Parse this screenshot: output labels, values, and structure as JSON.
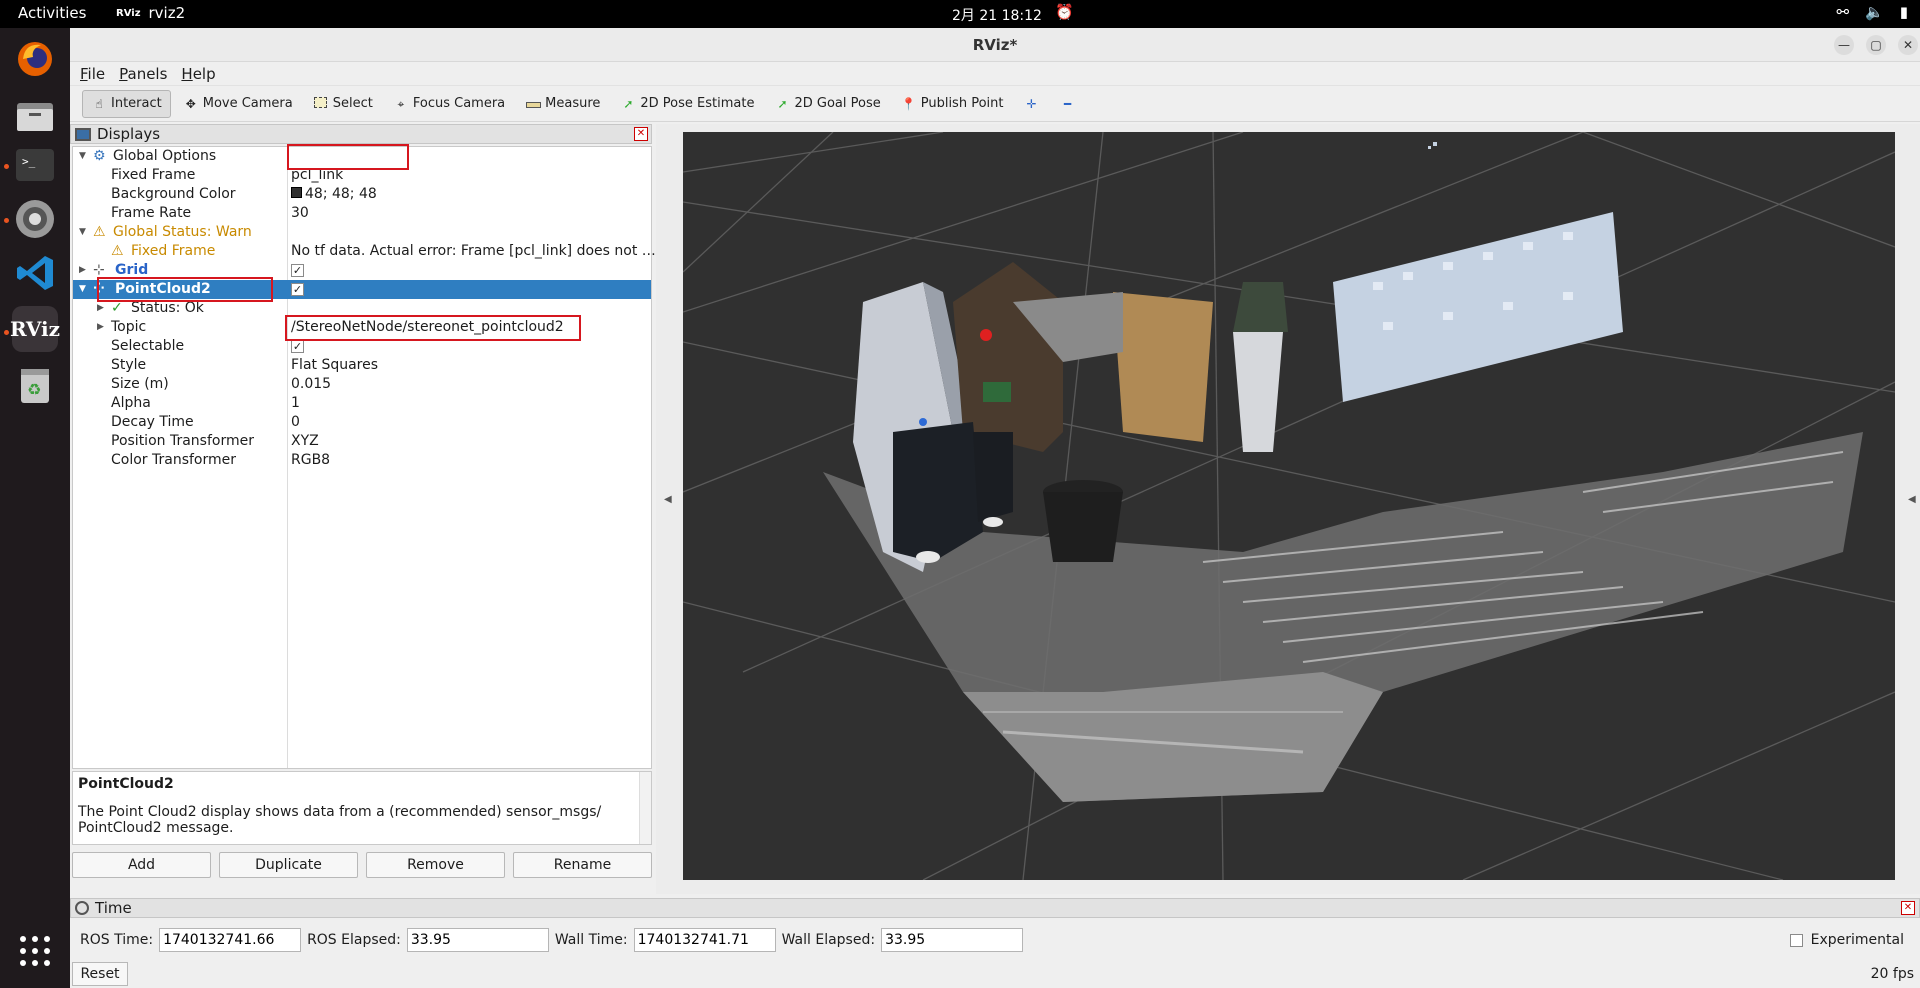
{
  "topbar": {
    "activities": "Activities",
    "app_name": "rviz2",
    "app_icon_text": "RViz",
    "clock": "2月 21  18:12"
  },
  "window": {
    "title": "RViz*",
    "minimize": "—",
    "maximize": "▢",
    "close": "✕"
  },
  "menu": [
    "File",
    "Panels",
    "Help"
  ],
  "toolbar": [
    {
      "label": "Interact",
      "icon": "hand-icon"
    },
    {
      "label": "Move Camera",
      "icon": "move-camera-icon"
    },
    {
      "label": "Select",
      "icon": "select-icon"
    },
    {
      "label": "Focus Camera",
      "icon": "focus-camera-icon"
    },
    {
      "label": "Measure",
      "icon": "ruler-icon"
    },
    {
      "label": "2D Pose Estimate",
      "icon": "green-arrow-icon"
    },
    {
      "label": "2D Goal Pose",
      "icon": "green-arrow-icon"
    },
    {
      "label": "Publish Point",
      "icon": "pin-icon"
    }
  ],
  "toolbar_extra": {
    "add": "✛",
    "remove": "━"
  },
  "displays": {
    "panel_title": "Displays",
    "rows": {
      "global_options": "Global Options",
      "fixed_frame_key": "Fixed Frame",
      "fixed_frame_val": "pcl_link",
      "bg_key": "Background Color",
      "bg_val": "48; 48; 48",
      "bg_swatch": "#303030",
      "rate_key": "Frame Rate",
      "rate_val": "30",
      "status_key": "Global Status: Warn",
      "ff_warn_key": "Fixed Frame",
      "ff_warn_val": "No tf data.  Actual error: Frame [pcl_link] does not …",
      "grid_key": "Grid",
      "pc2_key": "PointCloud2",
      "status_ok": "Status: Ok",
      "topic_key": "Topic",
      "topic_val": "/StereoNetNode/stereonet_pointcloud2",
      "selectable_key": "Selectable",
      "style_key": "Style",
      "style_val": "Flat Squares",
      "size_key": "Size (m)",
      "size_val": "0.015",
      "alpha_key": "Alpha",
      "alpha_val": "1",
      "decay_key": "Decay Time",
      "decay_val": "0",
      "postf_key": "Position Transformer",
      "postf_val": "XYZ",
      "coltf_key": "Color Transformer",
      "coltf_val": "RGB8"
    },
    "description_title": "PointCloud2",
    "description_text_1": "The Point Cloud2 display shows data from a (recommended) sensor_msgs/",
    "description_text_2": "PointCloud2 message.",
    "buttons": {
      "add": "Add",
      "duplicate": "Duplicate",
      "remove": "Remove",
      "rename": "Rename"
    }
  },
  "time": {
    "panel_title": "Time",
    "ros_time_label": "ROS Time:",
    "ros_time": "1740132741.66",
    "ros_elapsed_label": "ROS Elapsed:",
    "ros_elapsed": "33.95",
    "wall_time_label": "Wall Time:",
    "wall_time": "1740132741.71",
    "wall_elapsed_label": "Wall Elapsed:",
    "wall_elapsed": "33.95",
    "experimental": "Experimental",
    "reset": "Reset",
    "fps": "20 fps"
  }
}
